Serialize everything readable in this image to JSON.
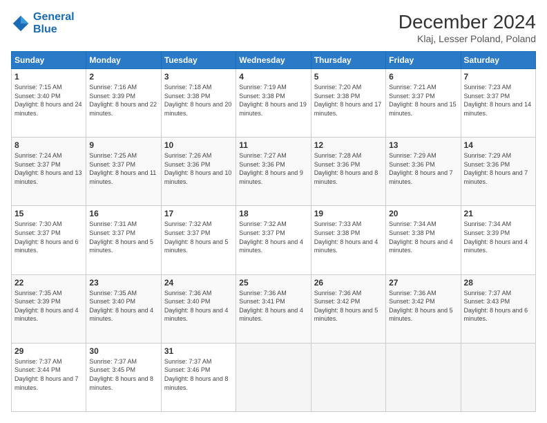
{
  "header": {
    "logo_line1": "General",
    "logo_line2": "Blue",
    "month_title": "December 2024",
    "subtitle": "Klaj, Lesser Poland, Poland"
  },
  "days_of_week": [
    "Sunday",
    "Monday",
    "Tuesday",
    "Wednesday",
    "Thursday",
    "Friday",
    "Saturday"
  ],
  "weeks": [
    [
      {
        "day": "1",
        "sunrise": "7:15 AM",
        "sunset": "3:40 PM",
        "daylight": "8 hours and 24 minutes."
      },
      {
        "day": "2",
        "sunrise": "7:16 AM",
        "sunset": "3:39 PM",
        "daylight": "8 hours and 22 minutes."
      },
      {
        "day": "3",
        "sunrise": "7:18 AM",
        "sunset": "3:38 PM",
        "daylight": "8 hours and 20 minutes."
      },
      {
        "day": "4",
        "sunrise": "7:19 AM",
        "sunset": "3:38 PM",
        "daylight": "8 hours and 19 minutes."
      },
      {
        "day": "5",
        "sunrise": "7:20 AM",
        "sunset": "3:38 PM",
        "daylight": "8 hours and 17 minutes."
      },
      {
        "day": "6",
        "sunrise": "7:21 AM",
        "sunset": "3:37 PM",
        "daylight": "8 hours and 15 minutes."
      },
      {
        "day": "7",
        "sunrise": "7:23 AM",
        "sunset": "3:37 PM",
        "daylight": "8 hours and 14 minutes."
      }
    ],
    [
      {
        "day": "8",
        "sunrise": "7:24 AM",
        "sunset": "3:37 PM",
        "daylight": "8 hours and 13 minutes."
      },
      {
        "day": "9",
        "sunrise": "7:25 AM",
        "sunset": "3:37 PM",
        "daylight": "8 hours and 11 minutes."
      },
      {
        "day": "10",
        "sunrise": "7:26 AM",
        "sunset": "3:36 PM",
        "daylight": "8 hours and 10 minutes."
      },
      {
        "day": "11",
        "sunrise": "7:27 AM",
        "sunset": "3:36 PM",
        "daylight": "8 hours and 9 minutes."
      },
      {
        "day": "12",
        "sunrise": "7:28 AM",
        "sunset": "3:36 PM",
        "daylight": "8 hours and 8 minutes."
      },
      {
        "day": "13",
        "sunrise": "7:29 AM",
        "sunset": "3:36 PM",
        "daylight": "8 hours and 7 minutes."
      },
      {
        "day": "14",
        "sunrise": "7:29 AM",
        "sunset": "3:36 PM",
        "daylight": "8 hours and 7 minutes."
      }
    ],
    [
      {
        "day": "15",
        "sunrise": "7:30 AM",
        "sunset": "3:37 PM",
        "daylight": "8 hours and 6 minutes."
      },
      {
        "day": "16",
        "sunrise": "7:31 AM",
        "sunset": "3:37 PM",
        "daylight": "8 hours and 5 minutes."
      },
      {
        "day": "17",
        "sunrise": "7:32 AM",
        "sunset": "3:37 PM",
        "daylight": "8 hours and 5 minutes."
      },
      {
        "day": "18",
        "sunrise": "7:32 AM",
        "sunset": "3:37 PM",
        "daylight": "8 hours and 4 minutes."
      },
      {
        "day": "19",
        "sunrise": "7:33 AM",
        "sunset": "3:38 PM",
        "daylight": "8 hours and 4 minutes."
      },
      {
        "day": "20",
        "sunrise": "7:34 AM",
        "sunset": "3:38 PM",
        "daylight": "8 hours and 4 minutes."
      },
      {
        "day": "21",
        "sunrise": "7:34 AM",
        "sunset": "3:39 PM",
        "daylight": "8 hours and 4 minutes."
      }
    ],
    [
      {
        "day": "22",
        "sunrise": "7:35 AM",
        "sunset": "3:39 PM",
        "daylight": "8 hours and 4 minutes."
      },
      {
        "day": "23",
        "sunrise": "7:35 AM",
        "sunset": "3:40 PM",
        "daylight": "8 hours and 4 minutes."
      },
      {
        "day": "24",
        "sunrise": "7:36 AM",
        "sunset": "3:40 PM",
        "daylight": "8 hours and 4 minutes."
      },
      {
        "day": "25",
        "sunrise": "7:36 AM",
        "sunset": "3:41 PM",
        "daylight": "8 hours and 4 minutes."
      },
      {
        "day": "26",
        "sunrise": "7:36 AM",
        "sunset": "3:42 PM",
        "daylight": "8 hours and 5 minutes."
      },
      {
        "day": "27",
        "sunrise": "7:36 AM",
        "sunset": "3:42 PM",
        "daylight": "8 hours and 5 minutes."
      },
      {
        "day": "28",
        "sunrise": "7:37 AM",
        "sunset": "3:43 PM",
        "daylight": "8 hours and 6 minutes."
      }
    ],
    [
      {
        "day": "29",
        "sunrise": "7:37 AM",
        "sunset": "3:44 PM",
        "daylight": "8 hours and 7 minutes."
      },
      {
        "day": "30",
        "sunrise": "7:37 AM",
        "sunset": "3:45 PM",
        "daylight": "8 hours and 8 minutes."
      },
      {
        "day": "31",
        "sunrise": "7:37 AM",
        "sunset": "3:46 PM",
        "daylight": "8 hours and 8 minutes."
      },
      null,
      null,
      null,
      null
    ]
  ]
}
